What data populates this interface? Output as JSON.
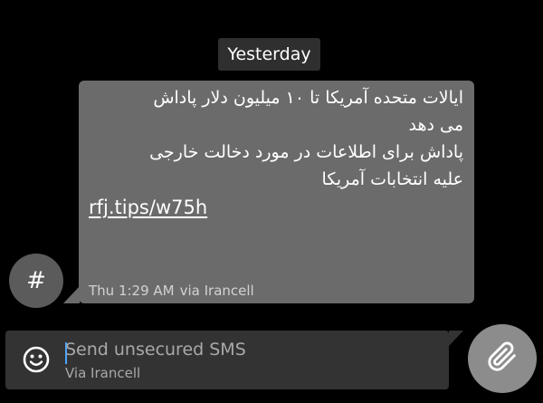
{
  "date_separator": "Yesterday",
  "sender": {
    "avatar_glyph": "#"
  },
  "message": {
    "lines": [
      "ایالات متحده آمریکا تا ۱۰ میلیون دلار پاداش",
      "می دهد",
      "پاداش برای اطلاعات در مورد دخالت خارجی",
      "علیه انتخابات آمریکا"
    ],
    "link": "rfj.tips/w75h",
    "time": "Thu 1:29 AM",
    "via": "via Irancell"
  },
  "composer": {
    "placeholder": "Send unsecured SMS",
    "subtext": "Via Irancell",
    "emoji_icon": "smiley-icon",
    "attach_icon": "paperclip-icon"
  },
  "colors": {
    "background": "#000000",
    "bubble": "#6b6b6b",
    "date_chip": "#2f2f2f",
    "input_bar": "#333333",
    "avatar": "#5b5b5b",
    "attach_button": "#8c8c8c",
    "caret": "#4aa3ff"
  }
}
